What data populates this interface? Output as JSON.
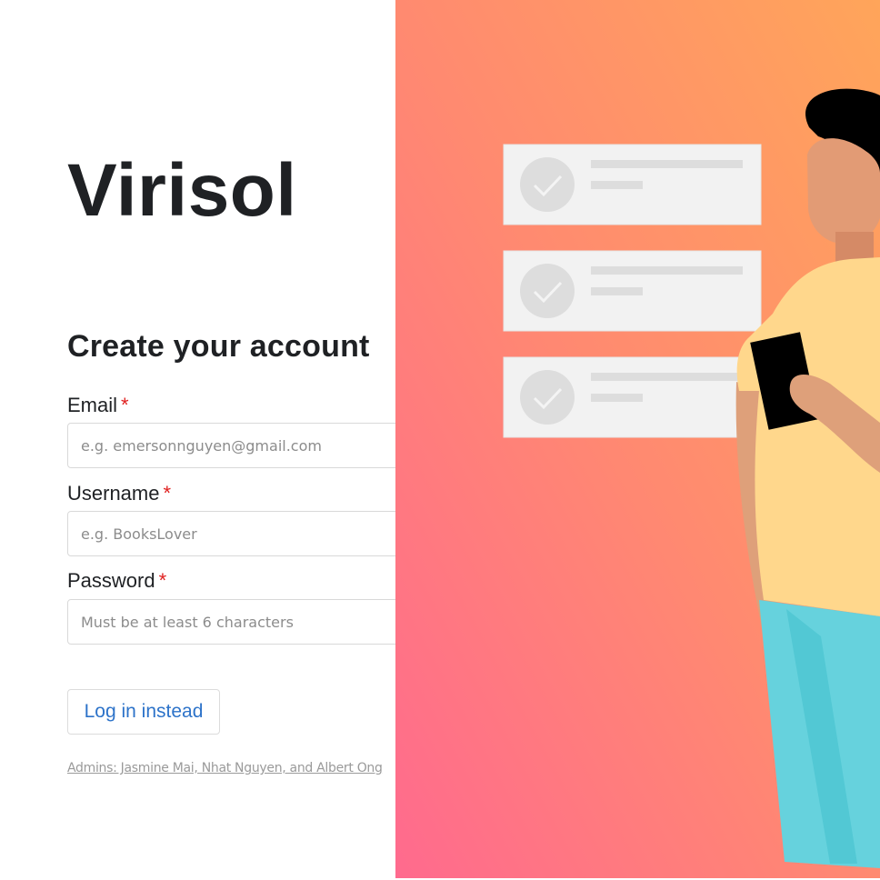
{
  "brand": {
    "name": "Virisol"
  },
  "form": {
    "title": "Create your account",
    "required_marker": "*",
    "fields": [
      {
        "label": "Email",
        "placeholder": "e.g. emersonnguyen@gmail.com",
        "value": ""
      },
      {
        "label": "Username",
        "placeholder": "e.g. BooksLover",
        "value": ""
      },
      {
        "label": "Password",
        "placeholder": "Must be at least 6 characters",
        "value": ""
      }
    ],
    "login_label": "Log in instead"
  },
  "footer": {
    "admins_text": "Admins: Jasmine Mai, Nhat Nguyen, and Albert Ong"
  },
  "colors": {
    "heading": "#1f2124",
    "required": "#e0201f",
    "link": "#2d73c9",
    "gradient_top": "#ffa35c",
    "gradient_bottom": "#ff6f8e"
  },
  "illustration": {
    "icons": [
      "check-card-icon",
      "check-card-icon",
      "check-card-icon",
      "person-holding-phone"
    ]
  }
}
